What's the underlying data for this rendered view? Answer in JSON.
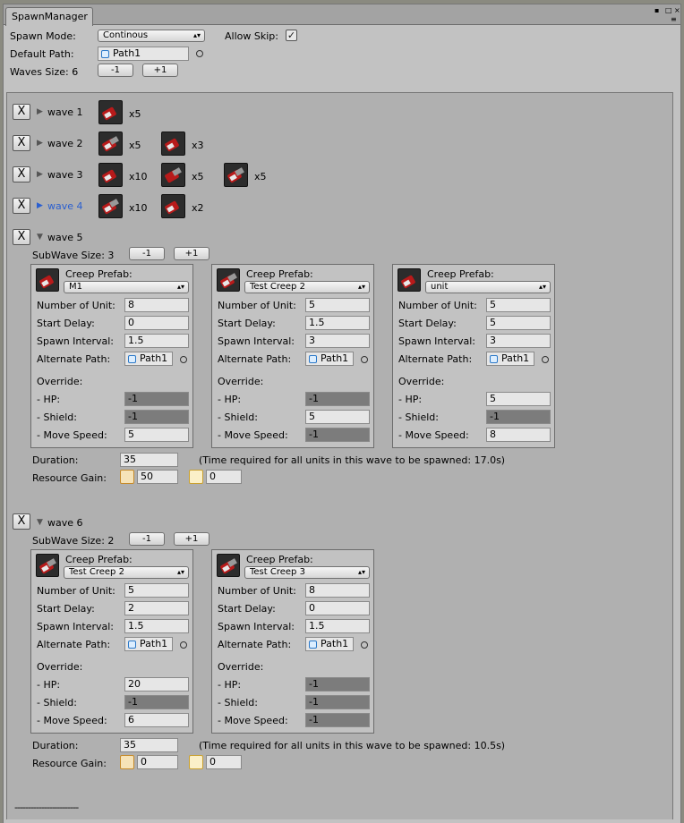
{
  "window": {
    "tab": "SpawnManager"
  },
  "header": {
    "spawn_mode_label": "Spawn Mode:",
    "spawn_mode_value": "Continous",
    "allow_skip_label": "Allow Skip:",
    "allow_skip_checked": true,
    "default_path_label": "Default Path:",
    "default_path_value": "Path1",
    "waves_size_label": "Waves Size: 6",
    "minus": "-1",
    "plus": "+1"
  },
  "collapsed_waves": [
    {
      "label": "wave 1",
      "units": [
        {
          "count": "x5"
        }
      ]
    },
    {
      "label": "wave 2",
      "units": [
        {
          "count": "x5"
        },
        {
          "count": "x3"
        }
      ]
    },
    {
      "label": "wave 3",
      "units": [
        {
          "count": "x10"
        },
        {
          "count": "x5"
        },
        {
          "count": "x5"
        }
      ]
    },
    {
      "label": "wave 4",
      "units": [
        {
          "count": "x10"
        },
        {
          "count": "x2"
        }
      ]
    }
  ],
  "labels": {
    "remove": "X",
    "creep_prefab": "Creep Prefab:",
    "number_of_unit": "Number of Unit:",
    "start_delay": "Start Delay:",
    "spawn_interval": "Spawn Interval:",
    "alternate_path": "Alternate Path:",
    "override": "Override:",
    "hp": "- HP:",
    "shield": "- Shield:",
    "move_speed": "- Move Speed:",
    "duration": "Duration:",
    "resource_gain": "Resource Gain:",
    "path": "Path1",
    "footer": "------------------------"
  },
  "wave5": {
    "label": "wave 5",
    "subwave_size": "SubWave Size: 3",
    "subwaves": [
      {
        "prefab": "M1",
        "num": "8",
        "delay": "0",
        "interval": "1.5",
        "hp": "-1",
        "shield": "-1",
        "speed": "5"
      },
      {
        "prefab": "Test Creep 2",
        "num": "5",
        "delay": "1.5",
        "interval": "3",
        "hp": "-1",
        "shield": "5",
        "speed": "-1"
      },
      {
        "prefab": "unit",
        "num": "5",
        "delay": "5",
        "interval": "3",
        "hp": "5",
        "shield": "-1",
        "speed": "8"
      }
    ],
    "duration": "35",
    "duration_note": "(Time required for all units in this wave to be spawned: 17.0s)",
    "resource1": "50",
    "resource2": "0"
  },
  "wave6": {
    "label": "wave 6",
    "subwave_size": "SubWave Size: 2",
    "subwaves": [
      {
        "prefab": "Test Creep 2",
        "num": "5",
        "delay": "2",
        "interval": "1.5",
        "hp": "20",
        "shield": "-1",
        "speed": "6"
      },
      {
        "prefab": "Test Creep 3",
        "num": "8",
        "delay": "0",
        "interval": "1.5",
        "hp": "-1",
        "shield": "-1",
        "speed": "-1"
      }
    ],
    "duration": "35",
    "duration_note": "(Time required for all units in this wave to be spawned: 10.5s)",
    "resource1": "0",
    "resource2": "0"
  }
}
